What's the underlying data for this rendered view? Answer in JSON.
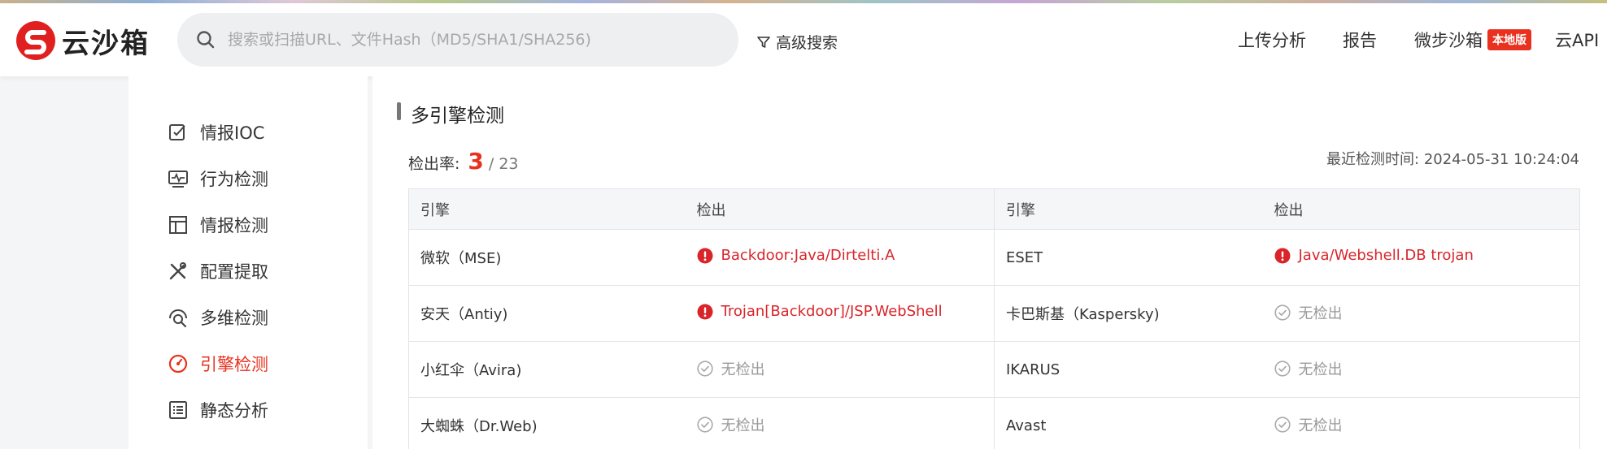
{
  "header": {
    "logo_text": "云沙箱",
    "search_placeholder": "搜索或扫描URL、文件Hash（MD5/SHA1/SHA256)",
    "advanced_search": "高级搜索",
    "nav": {
      "upload": "上传分析",
      "report": "报告",
      "sandbox": "微步沙箱",
      "sandbox_badge": "本地版",
      "api": "云API"
    }
  },
  "sidebar": {
    "items": [
      {
        "label": "情报IOC",
        "icon": "edit-check-icon"
      },
      {
        "label": "行为检测",
        "icon": "monitor-activity-icon"
      },
      {
        "label": "情报检测",
        "icon": "layout-icon"
      },
      {
        "label": "配置提取",
        "icon": "tools-icon"
      },
      {
        "label": "多维检测",
        "icon": "radar-search-icon"
      },
      {
        "label": "引擎检测",
        "icon": "engine-gauge-icon",
        "active": true
      },
      {
        "label": "静态分析",
        "icon": "list-icon"
      }
    ]
  },
  "main": {
    "section_title": "多引擎检测",
    "rate_label": "检出率:",
    "rate_detected": "3",
    "rate_total": "/ 23",
    "last_check_label": "最近检测时间:",
    "last_check_time": "2024-05-31 10:24:04",
    "table": {
      "headers": [
        "引擎",
        "检出",
        "引擎",
        "检出"
      ],
      "rows": [
        {
          "engine1": "微软（MSE)",
          "result1": "Backdoor:Java/Dirtelti.A",
          "detected1": true,
          "engine2": "ESET",
          "result2": "Java/Webshell.DB trojan",
          "detected2": true
        },
        {
          "engine1": "安天（Antiy)",
          "result1": "Trojan[Backdoor]/JSP.WebShell",
          "detected1": true,
          "engine2": "卡巴斯基（Kaspersky)",
          "result2": "无检出",
          "detected2": false
        },
        {
          "engine1": "小红伞（Avira)",
          "result1": "无检出",
          "detected1": false,
          "engine2": "IKARUS",
          "result2": "无检出",
          "detected2": false
        },
        {
          "engine1": "大蜘蛛（Dr.Web)",
          "result1": "无检出",
          "detected1": false,
          "engine2": "Avast",
          "result2": "无检出",
          "detected2": false
        }
      ]
    }
  },
  "colors": {
    "accent": "#e8321f",
    "detected": "#d9252a",
    "clean": "#999999"
  }
}
